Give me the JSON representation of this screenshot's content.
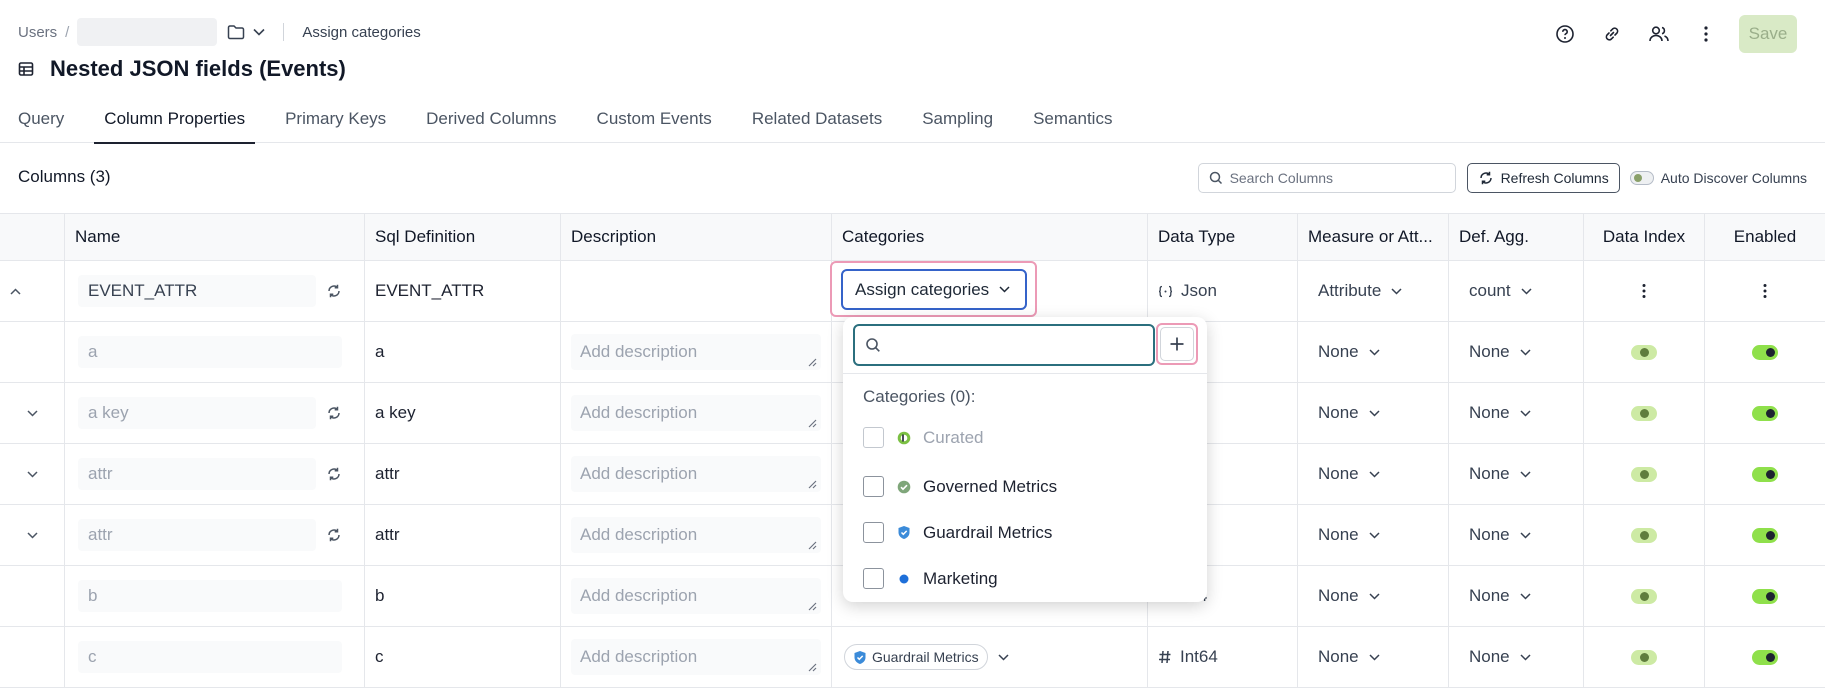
{
  "breadcrumb": {
    "root": "Users",
    "separator": "/",
    "current": "Assign categories"
  },
  "page": {
    "title": "Nested JSON fields (Events)"
  },
  "header_actions": {
    "save_label": "Save"
  },
  "tabs": [
    {
      "label": "Query"
    },
    {
      "label": "Column Properties"
    },
    {
      "label": "Primary Keys"
    },
    {
      "label": "Derived Columns"
    },
    {
      "label": "Custom Events"
    },
    {
      "label": "Related Datasets"
    },
    {
      "label": "Sampling"
    },
    {
      "label": "Semantics"
    }
  ],
  "active_tab": "Column Properties",
  "columns_section": {
    "title": "Columns (3)",
    "search_placeholder": "Search Columns",
    "refresh_label": "Refresh Columns",
    "auto_discover_label": "Auto Discover Columns"
  },
  "table": {
    "headers": [
      "Name",
      "Sql Definition",
      "Description",
      "Categories",
      "Data Type",
      "Measure or Att...",
      "Def. Agg.",
      "Data Index",
      "Enabled"
    ],
    "rows": [
      {
        "name": "EVENT_ATTR",
        "sql": "EVENT_ATTR",
        "description": "",
        "data_type": "Json",
        "measure": "Attribute",
        "agg": "count"
      },
      {
        "name": "a",
        "sql": "a",
        "description_placeholder": "Add description",
        "data_type": "4",
        "measure": "None",
        "agg": "None"
      },
      {
        "name": "a key",
        "sql": "a key",
        "description_placeholder": "Add description",
        "data_type": "n",
        "measure": "None",
        "agg": "None"
      },
      {
        "name": "attr",
        "sql": "attr",
        "description_placeholder": "Add description",
        "data_type": "n",
        "measure": "None",
        "agg": "None"
      },
      {
        "name": "attr",
        "sql": "attr",
        "description_placeholder": "Add description",
        "data_type": "n",
        "measure": "None",
        "agg": "None"
      },
      {
        "name": "b",
        "sql": "b",
        "description_placeholder": "Add description",
        "data_type": "4",
        "measure": "None",
        "agg": "None"
      },
      {
        "name": "c",
        "sql": "c",
        "description_placeholder": "Add description",
        "category_chip": "Guardrail Metrics",
        "data_type": "Int64",
        "measure": "None",
        "agg": "None"
      }
    ]
  },
  "assign_button_label": "Assign categories",
  "category_dropdown": {
    "search_value": "",
    "header": "Categories (0):",
    "items": [
      {
        "label": "Curated",
        "disabled": true,
        "icon": "curated-icon",
        "color": "#7bc043"
      },
      {
        "label": "Governed Metrics",
        "disabled": false,
        "icon": "check-badge-icon",
        "color": "#7fa67a"
      },
      {
        "label": "Guardrail Metrics",
        "disabled": false,
        "icon": "shield-icon",
        "color": "#3b8bd9"
      },
      {
        "label": "Marketing",
        "disabled": false,
        "icon": "dot-icon",
        "color": "#1e6fd9"
      }
    ]
  },
  "colors": {
    "save_bg": "#d9eac6",
    "assign_border": "#3563c9",
    "highlight": "#ec9ab6",
    "toggle_on": "#8fe04b",
    "toggle_light": "#cdeaa4"
  }
}
